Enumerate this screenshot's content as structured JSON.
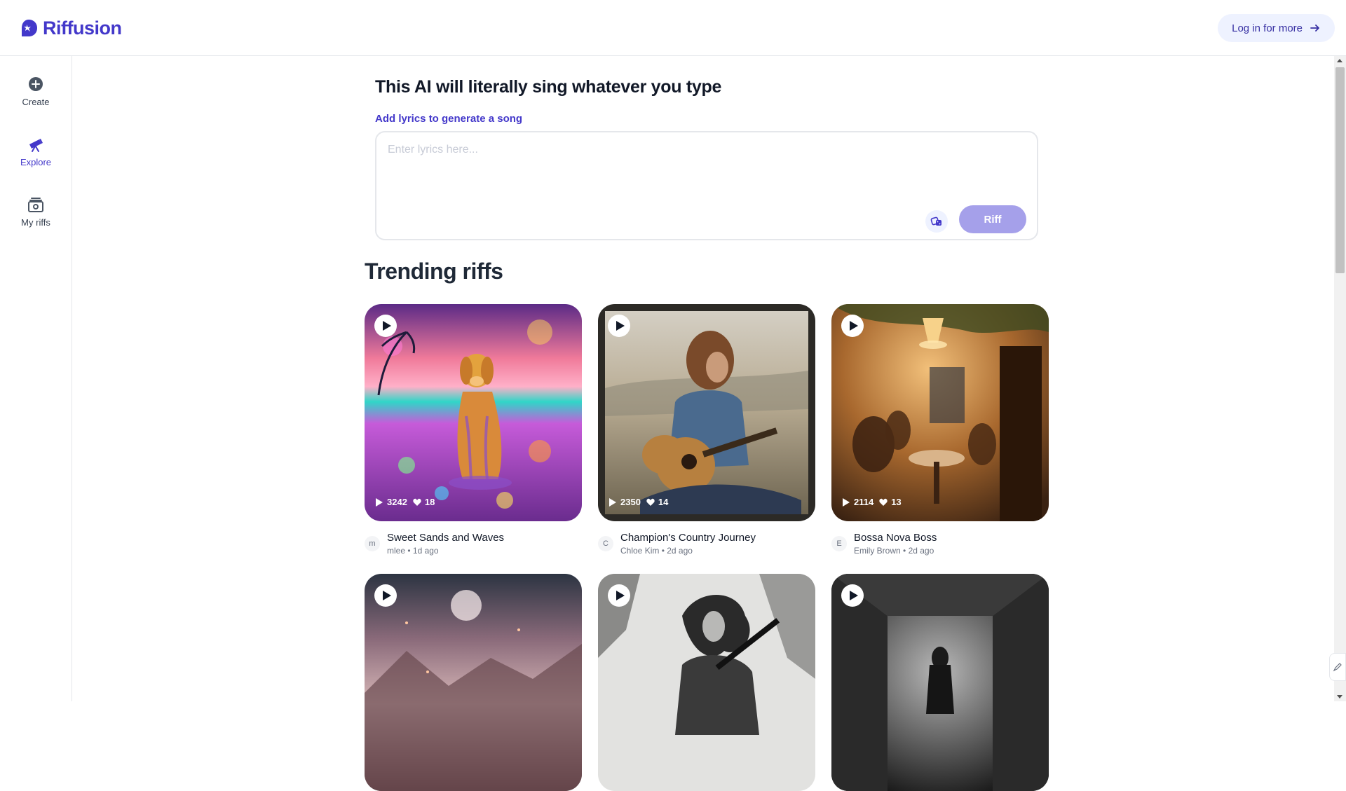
{
  "app": {
    "name": "Riffusion"
  },
  "header": {
    "login_label": "Log in for more"
  },
  "sidebar": {
    "items": [
      {
        "label": "Create",
        "icon": "plus-circle-icon"
      },
      {
        "label": "Explore",
        "icon": "telescope-icon"
      },
      {
        "label": "My riffs",
        "icon": "music-library-icon"
      }
    ]
  },
  "composer": {
    "title": "This AI will literally sing whatever you type",
    "lyrics_label": "Add lyrics to generate a song",
    "placeholder": "Enter lyrics here...",
    "riff_label": "Riff"
  },
  "trending": {
    "title": "Trending riffs",
    "riffs": [
      {
        "title": "Sweet Sands and Waves",
        "author": "mlee",
        "avatar": "m",
        "age": "1d ago",
        "plays": "3242",
        "likes": "18"
      },
      {
        "title": "Champion's Country Journey",
        "author": "Chloe Kim",
        "avatar": "C",
        "age": "2d ago",
        "plays": "2350",
        "likes": "14"
      },
      {
        "title": "Bossa Nova Boss",
        "author": "Emily Brown",
        "avatar": "E",
        "age": "2d ago",
        "plays": "2114",
        "likes": "13"
      },
      {
        "plays": "",
        "likes": ""
      },
      {
        "plays": "",
        "likes": ""
      },
      {
        "plays": "",
        "likes": ""
      }
    ]
  },
  "colors": {
    "brand": "#4338ca",
    "riff_button": "#a5a0ea",
    "login_bg": "#eef2ff"
  }
}
